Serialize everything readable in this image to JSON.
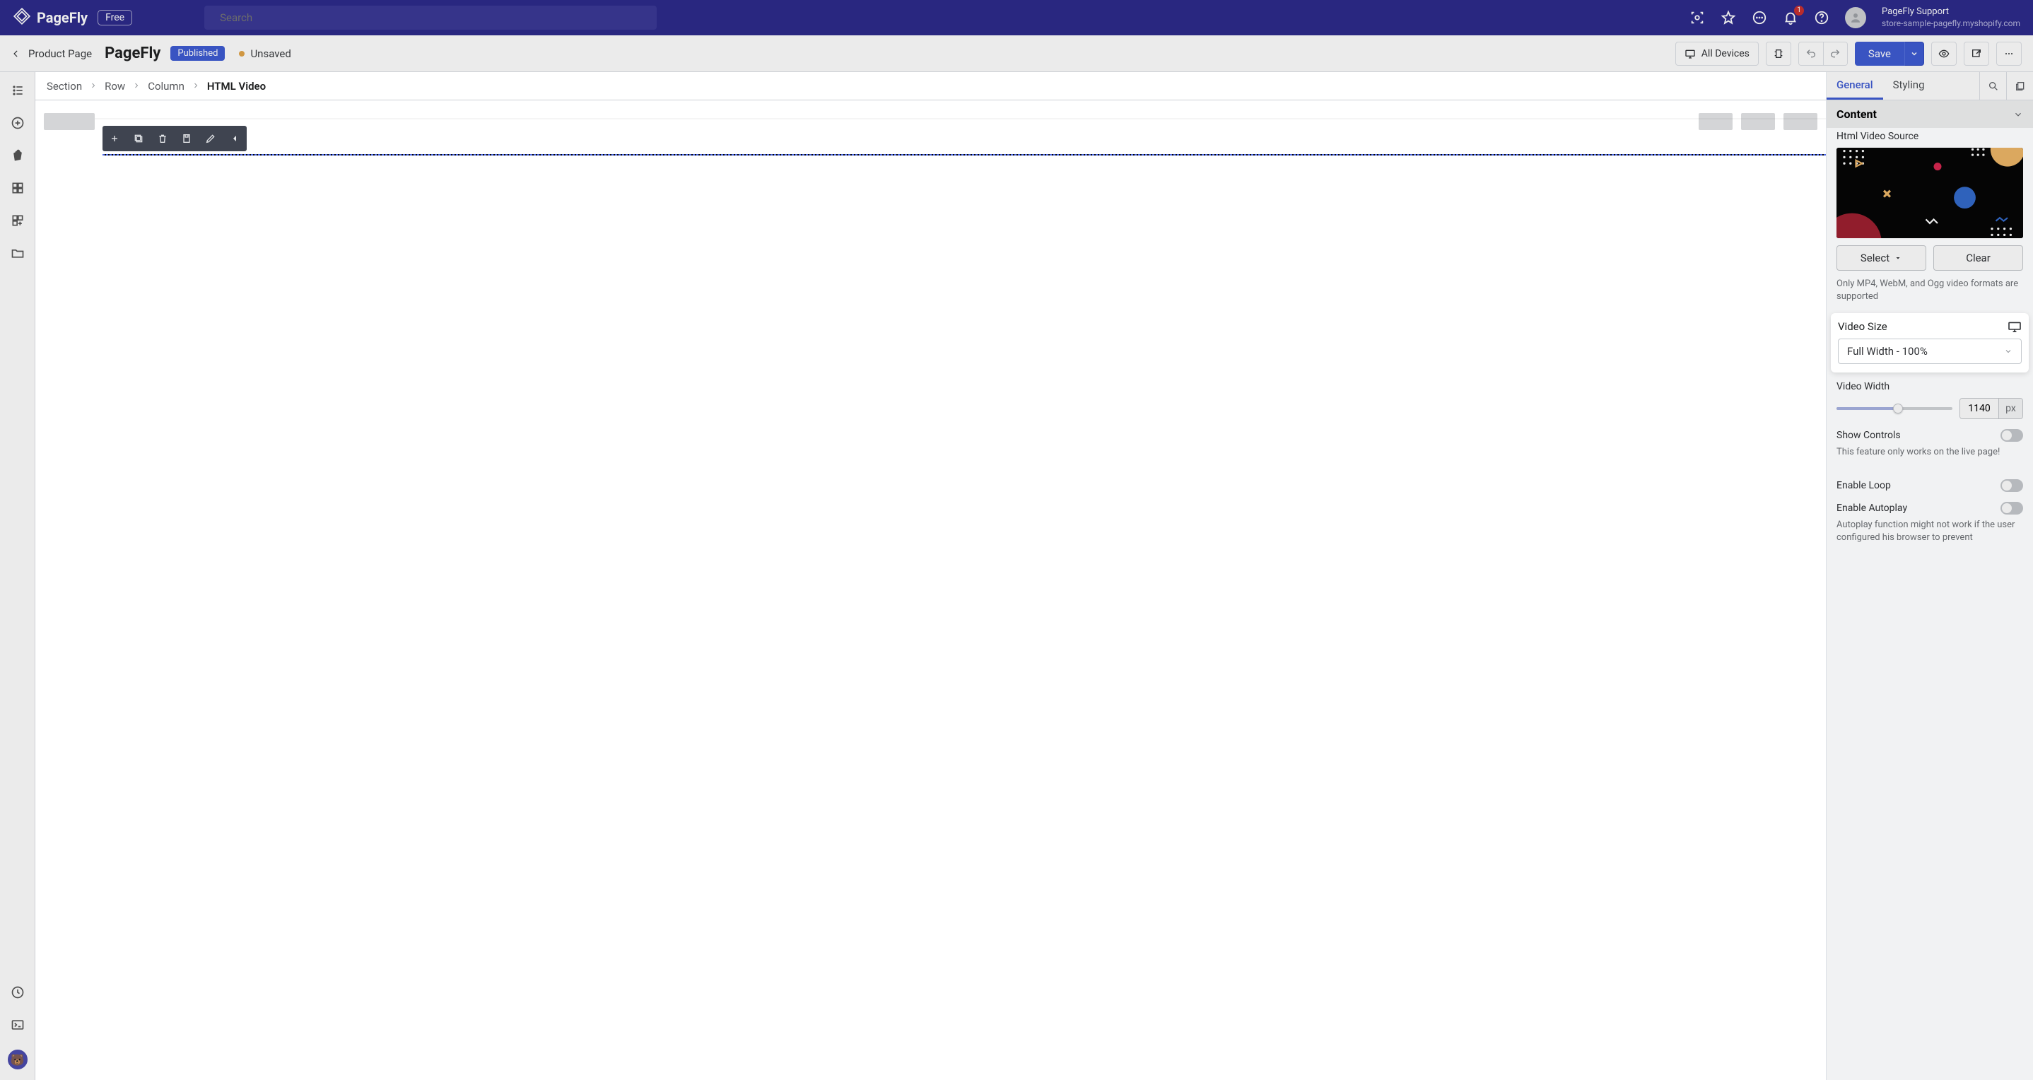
{
  "nav": {
    "brand": "PageFly",
    "plan_badge": "Free",
    "search_placeholder": "Search",
    "notif_count": "1",
    "user_name": "PageFly Support",
    "store_domain": "store-sample-pagefly.myshopify.com"
  },
  "secondbar": {
    "back_label": "Product Page",
    "page_name": "PageFly",
    "status_pill": "Published",
    "unsaved_label": "Unsaved",
    "devices_label": "All Devices",
    "save_label": "Save"
  },
  "breadcrumbs": [
    "Section",
    "Row",
    "Column",
    "HTML Video"
  ],
  "right_panel": {
    "tabs": {
      "general": "General",
      "styling": "Styling"
    },
    "section_title": "Content",
    "html_source_label": "Html Video Source",
    "select_btn": "Select",
    "clear_btn": "Clear",
    "format_help": "Only MP4, WebM, and Ogg video formats are supported",
    "video_size_label": "Video Size",
    "video_size_value": "Full Width - 100%",
    "video_width_label": "Video Width",
    "video_width_value": "1140",
    "video_width_unit": "px",
    "show_controls_label": "Show Controls",
    "show_controls_help": "This feature only works on the live page!",
    "enable_loop_label": "Enable Loop",
    "enable_autoplay_label": "Enable Autoplay",
    "autoplay_help": "Autoplay function might not work if the user configured his browser to prevent"
  }
}
